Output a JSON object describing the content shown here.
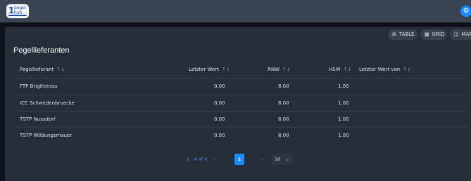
{
  "app": {
    "logo_number": "1",
    "logo_word_1": "pegel",
    "logo_word_2": "hub",
    "settings_icon": "⚙"
  },
  "views": [
    {
      "icon": "table-icon",
      "glyph": "⊞",
      "label": "TABLE"
    },
    {
      "icon": "grid-icon",
      "glyph": "▦",
      "label": "GRID"
    },
    {
      "icon": "map-icon",
      "glyph": "◫",
      "label": "MAP"
    }
  ],
  "page_title": "Pegellieferanten",
  "table": {
    "sort_glyph": "↑↓",
    "columns": [
      "Pegellieferant",
      "Letzter Wert",
      "RNW",
      "HSW",
      "Letzter Wert von"
    ],
    "rows": [
      [
        "FTP Brigittenau",
        "0.00",
        "8.00",
        "1.00",
        ""
      ],
      [
        "ICC Schwedenbruecke",
        "0.00",
        "8.00",
        "1.00",
        ""
      ],
      [
        "TSTP Nussdorf",
        "0.00",
        "8.00",
        "1.00",
        ""
      ],
      [
        "TSTP Wildungsmauer",
        "0.00",
        "8.00",
        "1.00",
        ""
      ]
    ]
  },
  "pagination": {
    "range": "1 - 4 of 4",
    "first": "«",
    "prev": "‹",
    "current_page": "1",
    "next": "›",
    "last": "»",
    "page_size": "10",
    "page_size_chevron": "⌄"
  }
}
